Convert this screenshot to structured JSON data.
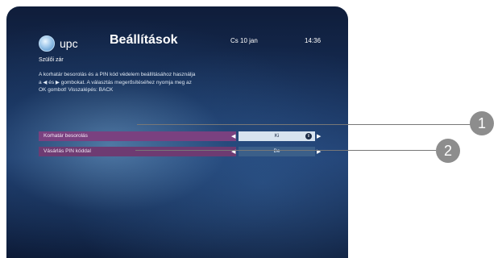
{
  "header": {
    "logo_text": "upc",
    "title": "Beállítások",
    "date": "Cs 10 jan",
    "time": "14:36"
  },
  "section_title": "Szülői zár",
  "description": [
    "A korhatár besorolás és a PIN kód védelem beállításához használja",
    "a ◀ és ▶ gombokat. A választás megerősítéséhez nyomja meg az",
    "OK gombot! Visszalépés: BACK"
  ],
  "settings": [
    {
      "label": "Korhatár besorolás",
      "value": "Ki",
      "selected": true
    },
    {
      "label": "Vásárlás PIN kóddal",
      "value": "Be",
      "selected": false
    }
  ],
  "callouts": [
    "1",
    "2"
  ],
  "icons": {
    "logo": "upc-logo-icon",
    "left_arrow": "left-arrow-icon",
    "right_arrow": "right-arrow-icon",
    "spinner": "up-down-spinner-icon"
  },
  "colors": {
    "label_bar": "#6e3b72",
    "value_box": "#3b5f89",
    "selected_value_box": "#d7e3ef",
    "callout": "#8d8d8d"
  }
}
